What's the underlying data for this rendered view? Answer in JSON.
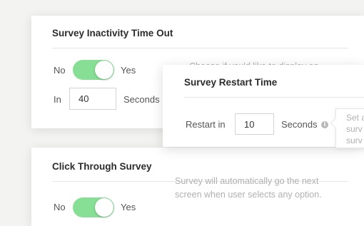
{
  "inactivity_card": {
    "title": "Survey Inactivity Time Out",
    "toggle_off_label": "No",
    "toggle_on_label": "Yes",
    "toggle_on": true,
    "in_label": "In",
    "timeout_value": "40",
    "seconds_label": "Seconds",
    "description": "Choose if you'd like to display an"
  },
  "restart_card": {
    "title": "Survey Restart Time",
    "restart_label": "Restart in",
    "restart_value": "10",
    "seconds_label": "Seconds",
    "info_icon": "info-icon",
    "tooltip_lines": [
      "Set a",
      "surv",
      "surv"
    ]
  },
  "click_through_card": {
    "title": "Click Through Survey",
    "toggle_off_label": "No",
    "toggle_on_label": "Yes",
    "toggle_on": true,
    "description_lines": [
      "Survey will automatically go the next",
      "screen when user selects any option."
    ]
  },
  "colors": {
    "toggle_on": "#86df94",
    "background": "#f3f3f1"
  }
}
